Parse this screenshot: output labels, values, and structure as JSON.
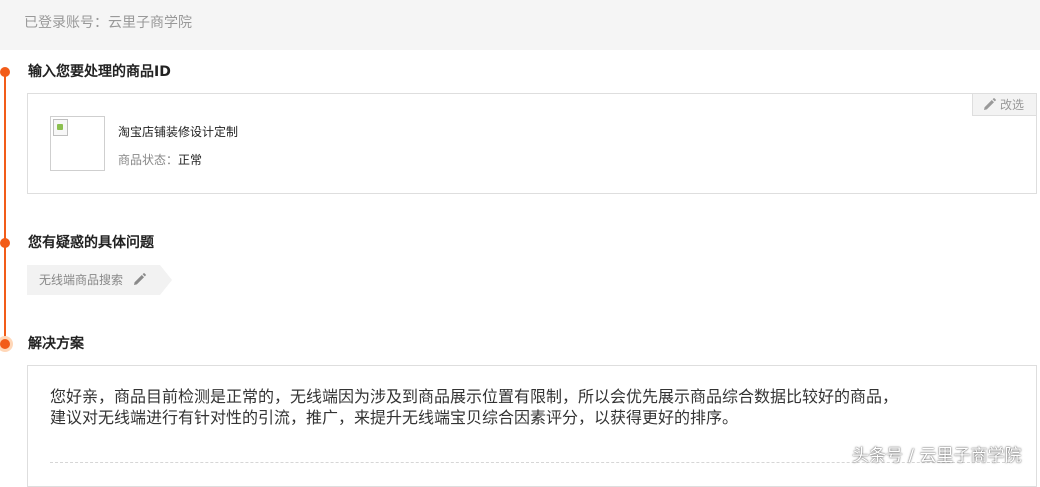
{
  "header": {
    "account_text": "已登录账号：云里子商学院"
  },
  "steps": [
    {
      "title": "输入您要处理的商品ID"
    },
    {
      "title": "您有疑惑的具体问题"
    },
    {
      "title": "解决方案"
    }
  ],
  "product": {
    "change_label": "改选",
    "name": "淘宝店铺装修设计定制",
    "status_label": "商品状态：",
    "status_value": "正常"
  },
  "question": {
    "tag_label": "无线端商品搜索"
  },
  "solution": {
    "line1": "您好亲，商品目前检测是正常的，无线端因为涉及到商品展示位置有限制，所以会优先展示商品综合数据比较好的商品，",
    "line2": "建议对无线端进行有针对性的引流，推广，来提升无线端宝贝综合因素评分，以获得更好的排序。"
  },
  "watermark": {
    "text": "头条号 / 云里子商学院"
  },
  "colors": {
    "accent": "#f25c19",
    "accent_light": "#ffd7b8"
  }
}
